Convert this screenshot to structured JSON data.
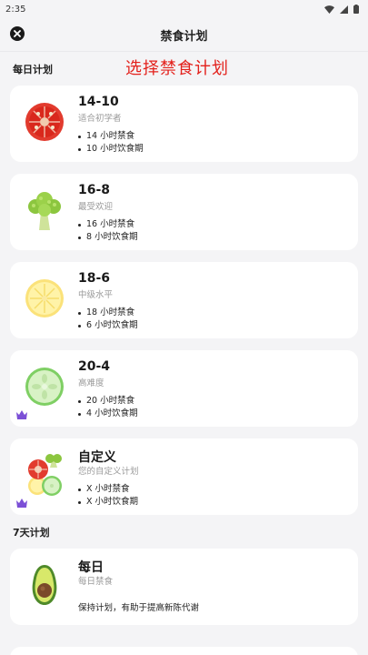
{
  "status_bar": {
    "time": "2:35",
    "icons": [
      "wifi-icon",
      "signal-icon",
      "battery-icon"
    ]
  },
  "header": {
    "title": "禁食计划",
    "close_icon": "close-icon"
  },
  "annotation": "选择禁食计划",
  "sections": {
    "daily": {
      "title": "每日计划"
    },
    "seven_day": {
      "title": "7天计划"
    }
  },
  "plans": [
    {
      "name": "14-10",
      "subtitle": "适合初学者",
      "bullets": [
        "14 小时禁食",
        "10 小时饮食期"
      ],
      "icon": "tomato-icon",
      "premium": false
    },
    {
      "name": "16-8",
      "subtitle": "最受欢迎",
      "bullets": [
        "16 小时禁食",
        "8 小时饮食期"
      ],
      "icon": "broccoli-icon",
      "premium": false
    },
    {
      "name": "18-6",
      "subtitle": "中级水平",
      "bullets": [
        "18 小时禁食",
        "6 小时饮食期"
      ],
      "icon": "lemon-icon",
      "premium": false
    },
    {
      "name": "20-4",
      "subtitle": "高难度",
      "bullets": [
        "20 小时禁食",
        "4 小时饮食期"
      ],
      "icon": "cucumber-icon",
      "premium": true
    },
    {
      "name": "自定义",
      "subtitle": "您的自定义计划",
      "bullets": [
        "X 小时禁食",
        "X 小时饮食期"
      ],
      "icon": "mixed-food-icon",
      "premium": true
    }
  ],
  "seven_day_plans": [
    {
      "name": "每日",
      "subtitle": "每日禁食",
      "description": "保持计划，有助于提高新陈代谢",
      "icon": "avocado-icon"
    }
  ],
  "colors": {
    "background": "#f4f4f6",
    "card": "#ffffff",
    "annotation": "#e3211c",
    "crown": "#7b4fd6"
  }
}
